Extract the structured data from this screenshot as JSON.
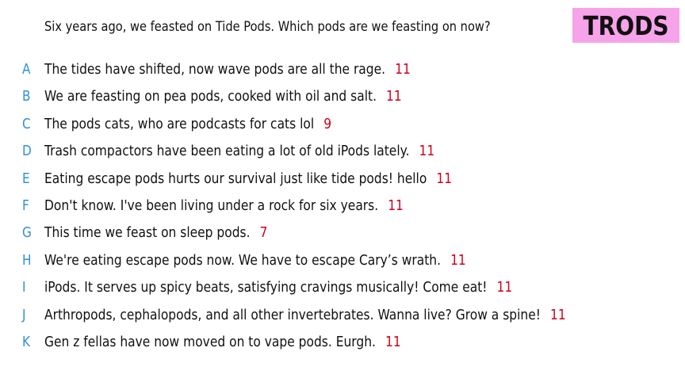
{
  "prompt": "Six years ago, we feasted on Tide Pods. Which pods are we feasting on now?",
  "title": "TRODS",
  "colors": {
    "badge_background": "#f7a3ea",
    "letter": "#2f90d8",
    "score": "#d0021b"
  },
  "answers": [
    {
      "letter": "A",
      "text": "The tides have shifted, now wave pods are all the rage.",
      "score": "11"
    },
    {
      "letter": "B",
      "text": "We are feasting on pea pods, cooked with oil and salt.",
      "score": "11"
    },
    {
      "letter": "C",
      "text": "The pods cats, who are podcasts for cats lol",
      "score": "9"
    },
    {
      "letter": "D",
      "text": "Trash compactors have been eating a lot of old iPods lately.",
      "score": "11"
    },
    {
      "letter": "E",
      "text": "Eating escape pods hurts our survival just like tide pods! hello",
      "score": "11"
    },
    {
      "letter": "F",
      "text": "Don't know. I've been living under a rock for six years.",
      "score": "11"
    },
    {
      "letter": "G",
      "text": "This time we feast on sleep pods.",
      "score": "7"
    },
    {
      "letter": "H",
      "text": "We're eating escape pods now. We have to escape Cary’s wrath.",
      "score": "11"
    },
    {
      "letter": "I",
      "text": "iPods. It serves up spicy beats, satisfying cravings musically! Come eat!",
      "score": "11"
    },
    {
      "letter": "J",
      "text": "Arthropods, cephalopods, and all other invertebrates. Wanna live? Grow a spine!",
      "score": "11"
    },
    {
      "letter": "K",
      "text": "Gen z fellas have now moved on to vape pods. Eurgh.",
      "score": "11"
    }
  ]
}
